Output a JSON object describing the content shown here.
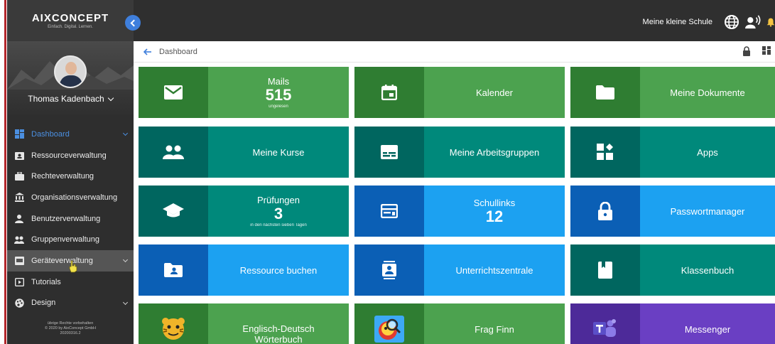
{
  "colors": {
    "green_dark": "#2f7d32",
    "green": "#4ca24f",
    "teal_dark": "#00665f",
    "teal": "#00897b",
    "blue_dark": "#0b5fb5",
    "blue": "#1ca1f1",
    "purple_dark": "#4d2a99",
    "purple": "#6a3fc3",
    "accent": "#3f7fdc"
  },
  "sidebar": {
    "logo": "AIXCONCEPT",
    "tagline": "Einfach. Digital. Lernen.",
    "user": "Thomas Kadenbach",
    "items": [
      {
        "label": "Dashboard",
        "icon": "dashboard-icon"
      },
      {
        "label": "Ressourceverwaltung",
        "icon": "resource-icon"
      },
      {
        "label": "Rechteverwaltung",
        "icon": "briefcase-icon"
      },
      {
        "label": "Organisationsverwaltung",
        "icon": "institution-icon"
      },
      {
        "label": "Benutzerverwaltung",
        "icon": "person-icon"
      },
      {
        "label": "Gruppenverwaltung",
        "icon": "group-icon"
      },
      {
        "label": "Geräteverwaltung",
        "icon": "device-icon"
      },
      {
        "label": "Tutorials",
        "icon": "tutorial-icon"
      },
      {
        "label": "Design",
        "icon": "palette-icon"
      }
    ],
    "footer": [
      "übrige Rechte vorbehalten",
      "© 2020 by AixConcept GmbH",
      "20200316.2"
    ]
  },
  "topbar": {
    "school": "Meine kleine Schule"
  },
  "breadcrumb": {
    "label": "Dashboard"
  },
  "tiles": [
    {
      "id": "mails",
      "title": "Mails",
      "number": "515",
      "sub": "ungelesen"
    },
    {
      "id": "kalender",
      "label": "Kalender"
    },
    {
      "id": "dokumente",
      "label": "Meine Dokumente"
    },
    {
      "id": "kurse",
      "label": "Meine Kurse"
    },
    {
      "id": "arbeitsgruppen",
      "label": "Meine Arbeitsgruppen"
    },
    {
      "id": "apps",
      "label": "Apps"
    },
    {
      "id": "pruefungen",
      "title": "Prüfungen",
      "number": "3",
      "sub": "in den nächsten sieben Tagen"
    },
    {
      "id": "schullinks",
      "title": "Schullinks",
      "number": "12"
    },
    {
      "id": "passwort",
      "label": "Passwortmanager"
    },
    {
      "id": "ressource",
      "label": "Ressource buchen"
    },
    {
      "id": "unterricht",
      "label": "Unterrichtszentrale"
    },
    {
      "id": "klassenbuch",
      "label": "Klassenbuch"
    },
    {
      "id": "woerterbuch",
      "label": "Englisch-Deutsch Wörterbuch"
    },
    {
      "id": "fragfinn",
      "label": "Frag Finn"
    },
    {
      "id": "messenger",
      "label": "Messenger"
    }
  ]
}
